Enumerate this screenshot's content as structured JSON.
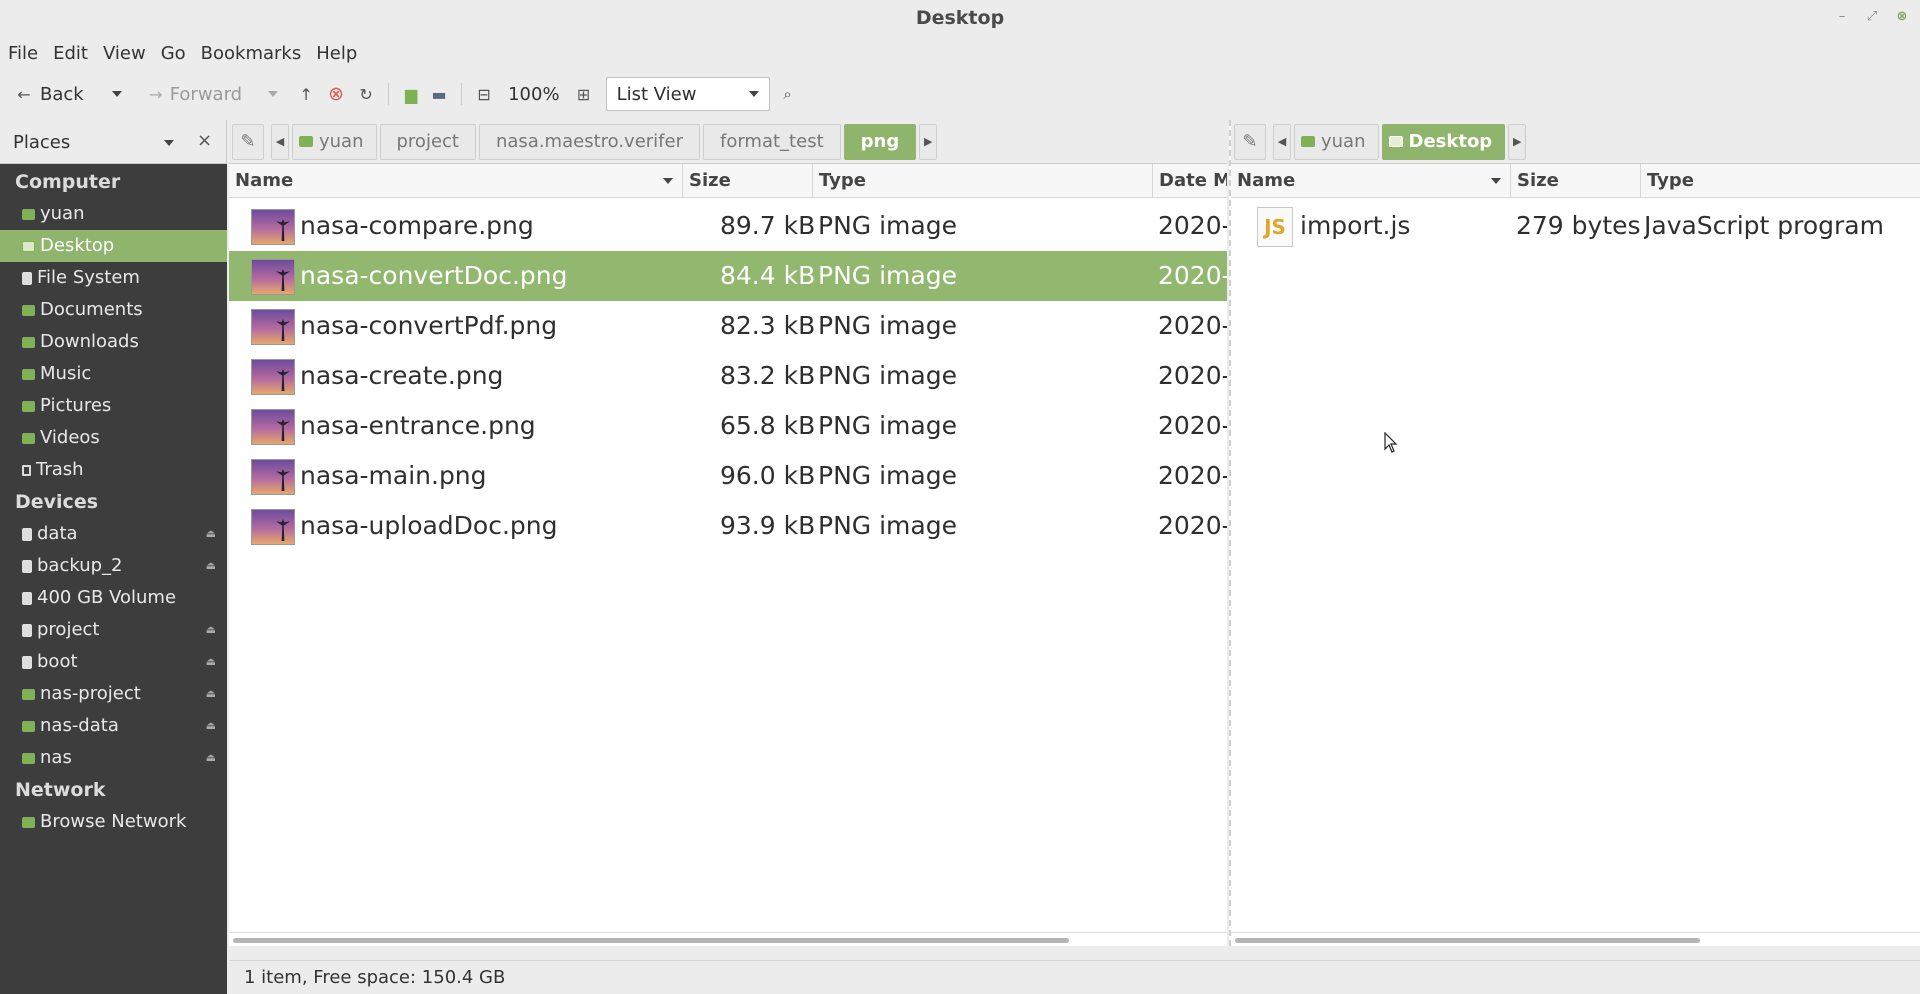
{
  "window": {
    "title": "Desktop"
  },
  "menubar": [
    "File",
    "Edit",
    "View",
    "Go",
    "Bookmarks",
    "Help"
  ],
  "toolbar": {
    "back": "Back",
    "forward": "Forward",
    "zoom": "100%",
    "view_mode": "List View"
  },
  "sidebar": {
    "header": "Places",
    "sections": {
      "computer": "Computer",
      "devices": "Devices",
      "network": "Network"
    },
    "computer_items": [
      {
        "label": "yuan",
        "icon": "home-folder-icon"
      },
      {
        "label": "Desktop",
        "icon": "desktop-icon",
        "selected": true
      },
      {
        "label": "File System",
        "icon": "drive-icon"
      },
      {
        "label": "Documents",
        "icon": "folder-icon"
      },
      {
        "label": "Downloads",
        "icon": "folder-icon"
      },
      {
        "label": "Music",
        "icon": "folder-icon"
      },
      {
        "label": "Pictures",
        "icon": "folder-icon"
      },
      {
        "label": "Videos",
        "icon": "folder-icon"
      },
      {
        "label": "Trash",
        "icon": "trash-icon"
      }
    ],
    "device_items": [
      {
        "label": "data",
        "eject": true
      },
      {
        "label": "backup_2",
        "eject": true
      },
      {
        "label": "400 GB Volume",
        "eject": false
      },
      {
        "label": "project",
        "eject": true
      },
      {
        "label": "boot",
        "eject": true
      },
      {
        "label": "nas-project",
        "eject": true
      },
      {
        "label": "nas-data",
        "eject": true
      },
      {
        "label": "nas",
        "eject": true
      }
    ],
    "network_items": [
      {
        "label": "Browse Network"
      }
    ]
  },
  "left_pane": {
    "breadcrumb": [
      "yuan",
      "project",
      "nasa.maestro.verifer",
      "format_test",
      "png"
    ],
    "columns": {
      "name": "Name",
      "size": "Size",
      "type": "Type",
      "date": "Date M"
    },
    "files": [
      {
        "name": "nasa-compare.png",
        "size": "89.7 kB",
        "type": "PNG image",
        "date": "2020-"
      },
      {
        "name": "nasa-convertDoc.png",
        "size": "84.4 kB",
        "type": "PNG image",
        "date": "2020-",
        "selected": true
      },
      {
        "name": "nasa-convertPdf.png",
        "size": "82.3 kB",
        "type": "PNG image",
        "date": "2020-"
      },
      {
        "name": "nasa-create.png",
        "size": "83.2 kB",
        "type": "PNG image",
        "date": "2020-"
      },
      {
        "name": "nasa-entrance.png",
        "size": "65.8 kB",
        "type": "PNG image",
        "date": "2020-"
      },
      {
        "name": "nasa-main.png",
        "size": "96.0 kB",
        "type": "PNG image",
        "date": "2020-"
      },
      {
        "name": "nasa-uploadDoc.png",
        "size": "93.9 kB",
        "type": "PNG image",
        "date": "2020-"
      }
    ]
  },
  "right_pane": {
    "breadcrumb": [
      "yuan",
      "Desktop"
    ],
    "columns": {
      "name": "Name",
      "size": "Size",
      "type": "Type"
    },
    "files": [
      {
        "name": "import.js",
        "size": "279 bytes",
        "type": "JavaScript program",
        "icon_text": "JS"
      }
    ]
  },
  "statusbar": {
    "text": "1 item, Free space: 150.4 GB"
  },
  "colors": {
    "accent": "#8fb56d",
    "sidebar_bg": "#3d3d3d"
  }
}
